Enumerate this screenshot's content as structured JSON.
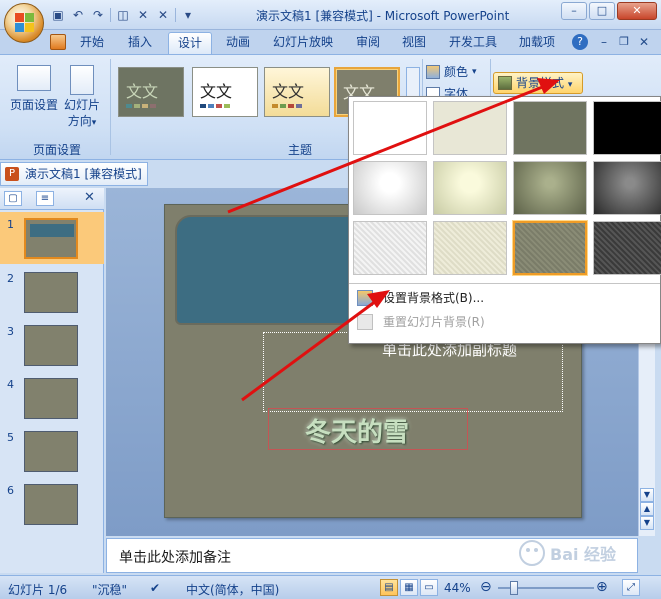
{
  "window": {
    "title": "演示文稿1 [兼容模式] - Microsoft PowerPoint",
    "controls": [
      "–",
      "□",
      "✕"
    ]
  },
  "tabs": [
    {
      "label": "开始"
    },
    {
      "label": "插入"
    },
    {
      "label": "设计"
    },
    {
      "label": "动画"
    },
    {
      "label": "幻灯片放映"
    },
    {
      "label": "审阅"
    },
    {
      "label": "视图"
    },
    {
      "label": "开发工具"
    },
    {
      "label": "加载项"
    }
  ],
  "ribbon": {
    "page_setup_label": "页面设置",
    "orientation_label_1": "幻灯片",
    "orientation_label_2": "方向",
    "orientation_arrow": "▾",
    "group_page_setup": "页面设置",
    "group_theme": "主题",
    "theme_sample_text": "文文",
    "colors_label": "颜色",
    "fonts_label": "字体",
    "bg_styles_label": "背景样式",
    "dropdown_arrow": "▾"
  },
  "document_tab": {
    "label": "演示文稿1 [兼容模式]"
  },
  "slides_panel": {
    "slides": [
      {
        "n": "1"
      },
      {
        "n": "2"
      },
      {
        "n": "3"
      },
      {
        "n": "4"
      },
      {
        "n": "5"
      },
      {
        "n": "6"
      }
    ]
  },
  "slide": {
    "subtitle_placeholder": "单击此处添加副标题",
    "title": "冬天的雪"
  },
  "notes": {
    "placeholder": "单击此处添加备注"
  },
  "status": {
    "slide_count": "幻灯片 1/6",
    "theme": "\"沉稳\"",
    "language": "中文(简体，中国)",
    "zoom": "44%"
  },
  "dropdown": {
    "format_bg": "设置背景格式(B)...",
    "reset_bg": "重置幻灯片背景(R)"
  },
  "watermark": {
    "text": "Bai 经验"
  },
  "colors": {
    "accent": "#e8a53b",
    "slide_bg": "#7f7f6c",
    "header_box": "#3d6d82",
    "arrow": "#e01010"
  }
}
